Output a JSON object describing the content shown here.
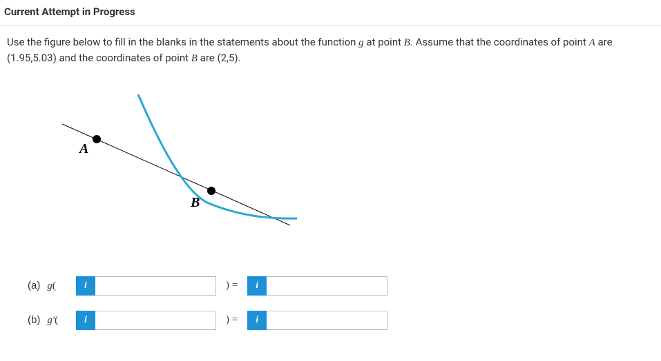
{
  "header": "Current Attempt in Progress",
  "prompt": {
    "t1": "Use the figure below to fill in the blanks in the statements about the function ",
    "g": "g",
    "t2": " at point ",
    "B1": "B",
    "t3": ". Assume that the coordinates of point ",
    "A": "A",
    "t4": " are (1.95,5.03) and the coordinates of point ",
    "B2": "B",
    "t5": " are (2,5)."
  },
  "figure": {
    "labelA": "A",
    "labelB": "B"
  },
  "hint_glyph": "i",
  "rows": {
    "a": {
      "part": "(a)",
      "fn": "g",
      "open": "(",
      "mid": ") =",
      "v1": "",
      "v2": ""
    },
    "b": {
      "part": "(b)",
      "fn": "g′",
      "open": "(",
      "mid": ") =",
      "v1": "",
      "v2": ""
    }
  }
}
